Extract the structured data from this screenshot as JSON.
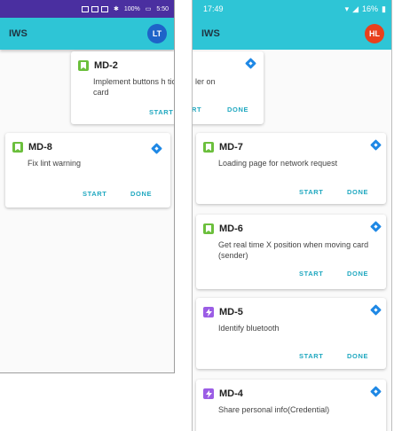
{
  "colors": {
    "accent": "#2ec5d6",
    "status_left": "#4a2fa0",
    "button_text": "#20a8c0",
    "badge_story": "#6bbf3c",
    "badge_task": "#9b5de5",
    "priority": "#1e88e5",
    "avatar_left": "#1e63c8",
    "avatar_right": "#e8401c"
  },
  "left_phone": {
    "status": {
      "battery": "100%",
      "time": "5:50"
    },
    "app_title": "IWS",
    "avatar": "LT",
    "cards": [
      {
        "id": "MD-2",
        "desc": "Implement buttons h ticket card",
        "badge": "bookmark-icon",
        "start": "START"
      },
      {
        "id": "MD-8",
        "desc": "Fix lint warning",
        "badge": "bookmark-icon",
        "start": "START",
        "done": "DONE"
      }
    ]
  },
  "right_phone": {
    "status": {
      "time": "17:49",
      "battery": "16%"
    },
    "app_title": "IWS",
    "avatar": "HL",
    "partial_card": {
      "desc": "ler on",
      "start_fragment": "RT",
      "done": "DONE"
    },
    "cards": [
      {
        "id": "MD-7",
        "desc": "Loading page for network request",
        "badge": "bookmark-icon",
        "start": "START",
        "done": "DONE"
      },
      {
        "id": "MD-6",
        "desc": "Get real time X position when moving card (sender)",
        "badge": "bookmark-icon",
        "start": "START",
        "done": "DONE"
      },
      {
        "id": "MD-5",
        "desc": "Identify bluetooth",
        "badge": "lightning-icon",
        "start": "START",
        "done": "DONE"
      },
      {
        "id": "MD-4",
        "desc": "Share personal info(Credential)",
        "badge": "lightning-icon"
      }
    ]
  }
}
